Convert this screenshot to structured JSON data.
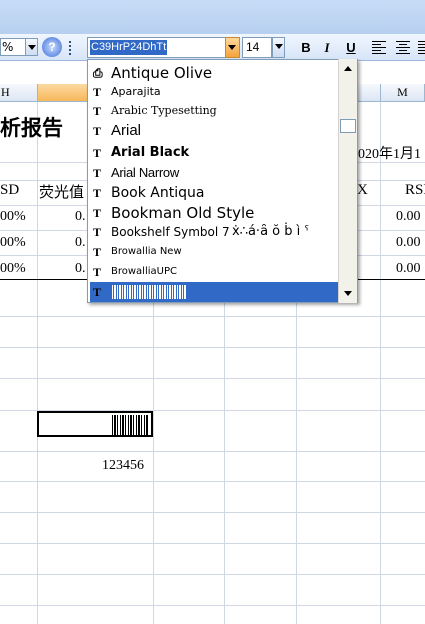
{
  "toolbar": {
    "zoom_value": "%",
    "help_label": "?",
    "font_name": "C39HrP24DhTt",
    "font_size": "14",
    "bold_label": "B",
    "italic_label": "I",
    "underline_label": "U"
  },
  "columns": {
    "h_label": "H",
    "m_label": "M"
  },
  "sheet": {
    "report_title_fragment": "析报告",
    "date_fragment": "020年1月1",
    "rsd_header_left": "SD",
    "fluorescence_header": "荧光值",
    "col_header_fragment": "X",
    "rsd_header_right": "RSD",
    "rows": [
      {
        "left": "00%",
        "fluor": "0.",
        "right": "0.00"
      },
      {
        "left": "00%",
        "fluor": "0.",
        "right": "0.00"
      },
      {
        "left": "00%",
        "fluor": "0.",
        "right": "0.00"
      }
    ],
    "value_below_barcode": "123456"
  },
  "font_list": [
    {
      "name": "Antique Olive",
      "icon": "printer-font-icon"
    },
    {
      "name": "Aparajita",
      "icon": "truetype-icon"
    },
    {
      "name": "Arabic Typesetting",
      "icon": "truetype-icon"
    },
    {
      "name": "Arial",
      "icon": "truetype-icon"
    },
    {
      "name": "Arial Black",
      "icon": "truetype-icon"
    },
    {
      "name": "Arial Narrow",
      "icon": "truetype-icon"
    },
    {
      "name": "Book Antiqua",
      "icon": "truetype-icon"
    },
    {
      "name": "Bookman Old Style",
      "icon": "truetype-icon"
    },
    {
      "name": "Bookshelf Symbol 7",
      "icon": "truetype-icon"
    },
    {
      "name": "Browallia New",
      "icon": "truetype-icon"
    },
    {
      "name": "BrowalliaUPC",
      "icon": "truetype-icon"
    },
    {
      "name": "",
      "icon": "truetype-icon"
    }
  ],
  "bookshelf_symbol_glyphs": "ẋ∴á‧ȃ ŏ ḃ ì ˁ",
  "truetype_glyph": "T",
  "printer_glyph": "⎙"
}
